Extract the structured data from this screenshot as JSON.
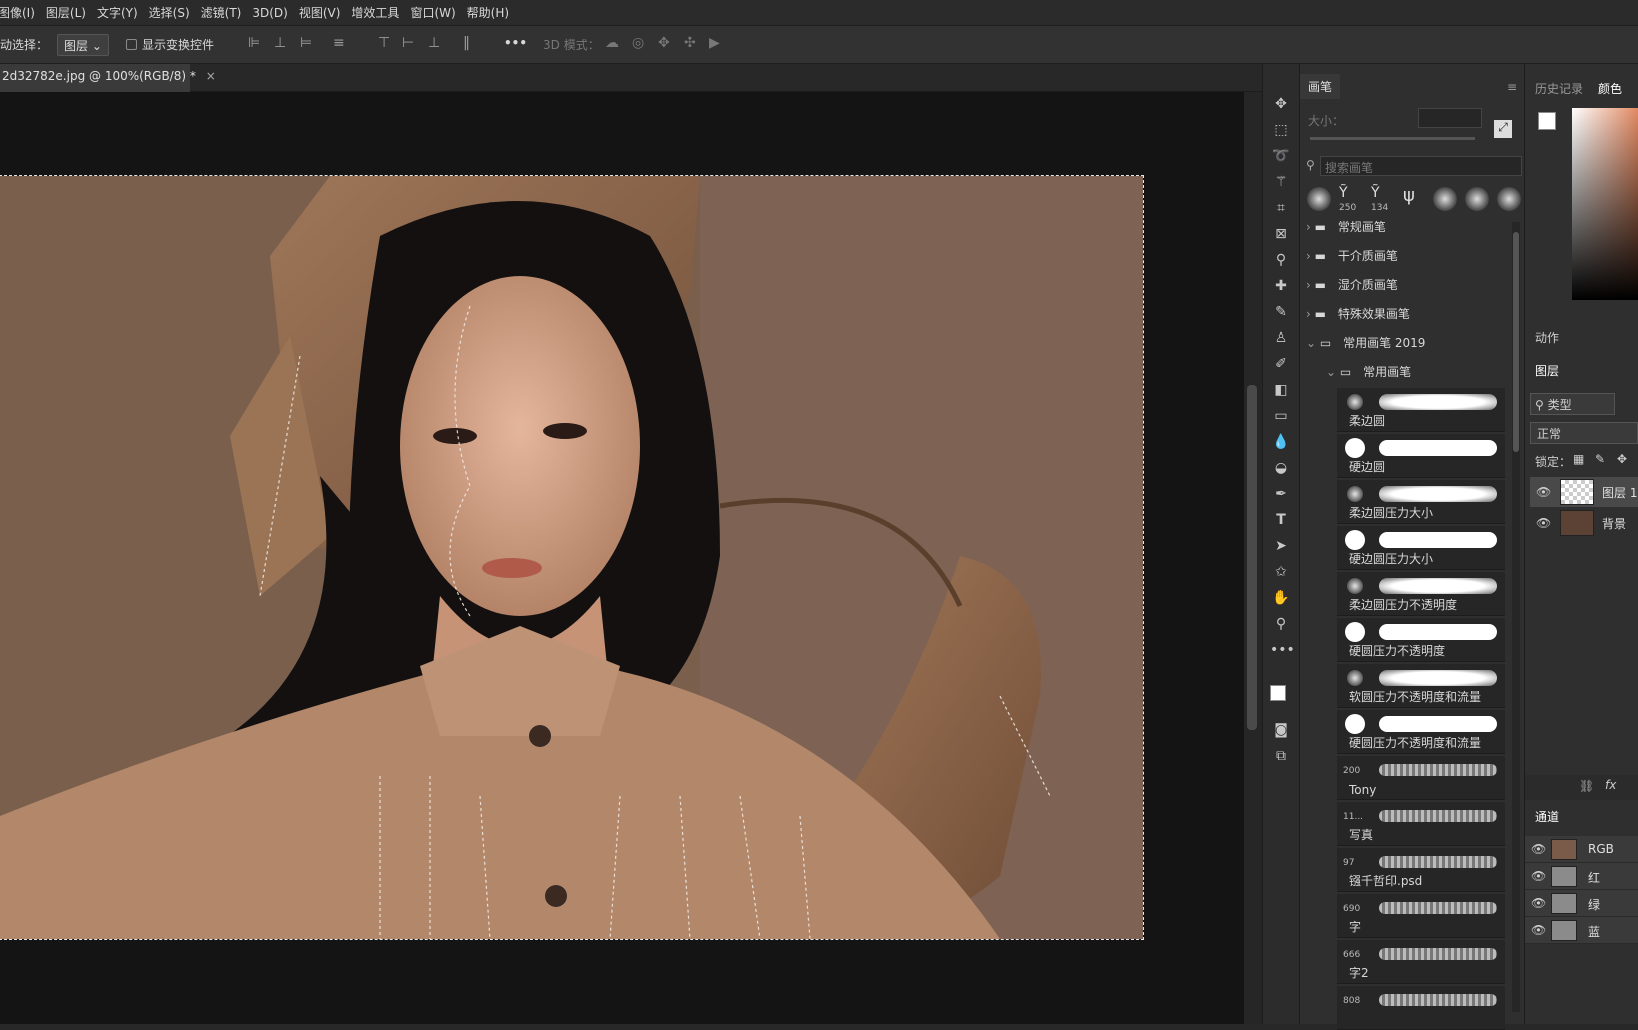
{
  "menu": [
    "图像(I)",
    "图层(L)",
    "文字(Y)",
    "选择(S)",
    "滤镜(T)",
    "3D(D)",
    "视图(V)",
    "增效工具",
    "窗口(W)",
    "帮助(H)"
  ],
  "options": {
    "auto_select_label": "动选择：",
    "auto_select_value": "图层",
    "show_transform_label": "显示变换控件",
    "more": "•••",
    "mode_3d_label": "3D 模式："
  },
  "doc_tab": {
    "title": "2d32782e.jpg @ 100%(RGB/8) *",
    "close": "×"
  },
  "brush_panel": {
    "tab": "画笔",
    "size_label": "大小：",
    "search_placeholder": "搜索画笔",
    "preset_tips": [
      "250",
      "134"
    ],
    "folders": [
      "常规画笔",
      "干介质画笔",
      "湿介质画笔",
      "特殊效果画笔",
      "常用画笔 2019",
      "常用画笔"
    ],
    "brushes": [
      {
        "name": "柔边圆",
        "tip": "",
        "kind": "soft"
      },
      {
        "name": "硬边圆",
        "tip": "",
        "kind": "hard"
      },
      {
        "name": "柔边圆压力大小",
        "tip": "",
        "kind": "soft"
      },
      {
        "name": "硬边圆压力大小",
        "tip": "",
        "kind": "hard"
      },
      {
        "name": "柔边圆压力不透明度",
        "tip": "",
        "kind": "soft"
      },
      {
        "name": "硬圆压力不透明度",
        "tip": "",
        "kind": "hard"
      },
      {
        "name": "软圆压力不透明度和流量",
        "tip": "",
        "kind": "soft"
      },
      {
        "name": "硬圆压力不透明度和流量",
        "tip": "",
        "kind": "hard"
      },
      {
        "name": "Tony",
        "tip": "200",
        "kind": "tex"
      },
      {
        "name": "写真",
        "tip": "11...",
        "kind": "tex"
      },
      {
        "name": "镪千哲印.psd",
        "tip": "97",
        "kind": "tex"
      },
      {
        "name": "字",
        "tip": "690",
        "kind": "tex"
      },
      {
        "name": "字2",
        "tip": "666",
        "kind": "tex"
      },
      {
        "name": "",
        "tip": "808",
        "kind": "tex"
      }
    ]
  },
  "right_panel": {
    "tab_history": "历史记录",
    "tab_color": "颜色",
    "actions": "动作",
    "layers_tab": "图层",
    "filter_kind": "类型",
    "blend_mode": "正常",
    "lock_label": "锁定：",
    "layers": [
      "图层 1",
      "背景"
    ],
    "fx": "fx",
    "channels_tab": "通道",
    "channels": [
      "RGB",
      "红",
      "绿",
      "蓝"
    ]
  },
  "colors": {
    "accent": "#1473e6",
    "bg": "#282828"
  }
}
